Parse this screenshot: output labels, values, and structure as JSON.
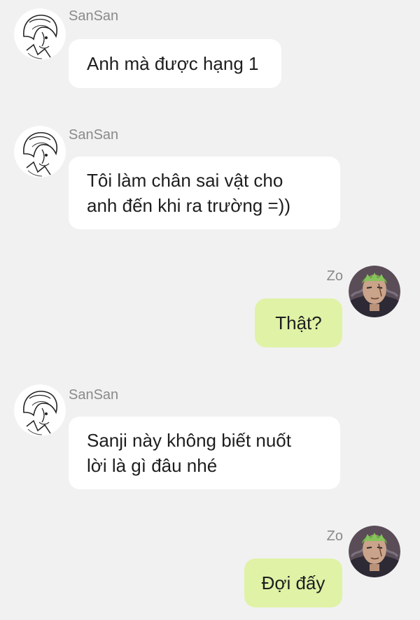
{
  "colors": {
    "background": "#f1f1f1",
    "incoming_bubble": "#ffffff",
    "outgoing_bubble": "#dff2a6",
    "sender_name": "#8a8a8a",
    "text": "#1e1e1e"
  },
  "messages": [
    {
      "sender": "SanSan",
      "direction": "incoming",
      "avatar": "sanji-avatar",
      "lines": [
        "Anh mà được hạng 1"
      ]
    },
    {
      "sender": "SanSan",
      "direction": "incoming",
      "avatar": "sanji-avatar",
      "lines": [
        "Tôi làm chân sai vật cho",
        "anh đến khi ra trường =))"
      ]
    },
    {
      "sender": "Zo",
      "direction": "outgoing",
      "avatar": "zoro-avatar",
      "lines": [
        "Thật?"
      ]
    },
    {
      "sender": "SanSan",
      "direction": "incoming",
      "avatar": "sanji-avatar",
      "lines": [
        "Sanji này không biết nuốt",
        "lời là gì đâu nhé"
      ]
    },
    {
      "sender": "Zo",
      "direction": "outgoing",
      "avatar": "zoro-avatar",
      "lines": [
        "Đợi đấy"
      ]
    }
  ]
}
